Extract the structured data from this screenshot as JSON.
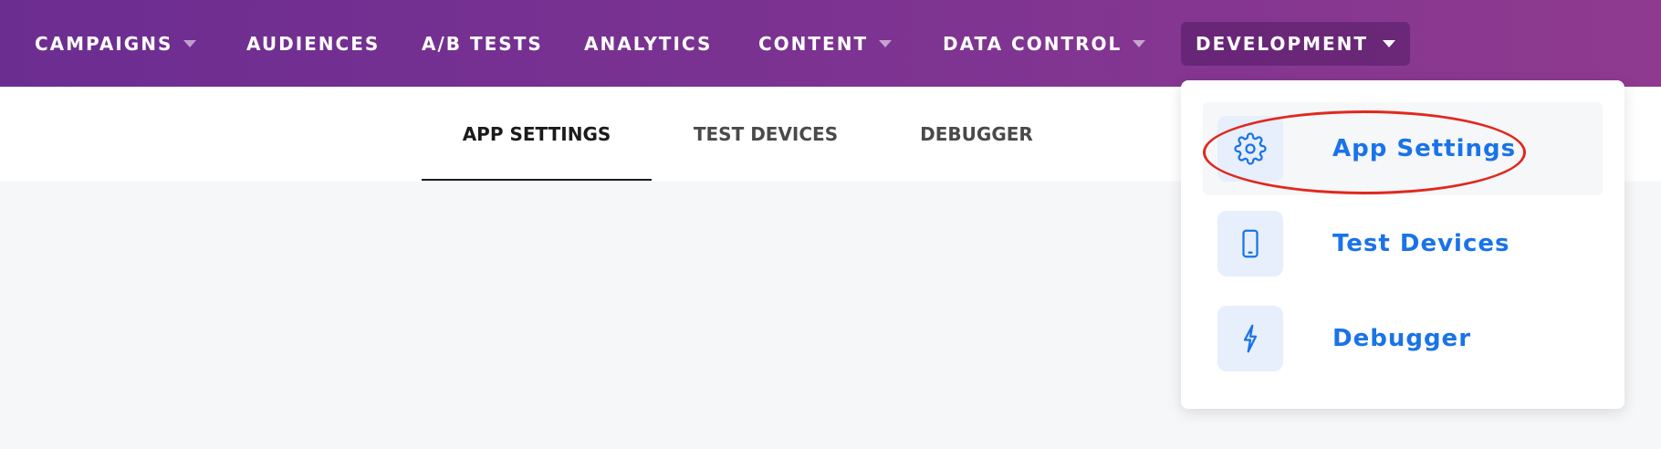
{
  "topnav": {
    "items": [
      {
        "label": "CAMPAIGNS",
        "dropdown": true
      },
      {
        "label": "AUDIENCES",
        "dropdown": false
      },
      {
        "label": "A/B TESTS",
        "dropdown": false
      },
      {
        "label": "ANALYTICS",
        "dropdown": false
      },
      {
        "label": "CONTENT",
        "dropdown": true
      },
      {
        "label": "DATA CONTROL",
        "dropdown": true
      },
      {
        "label": "DEVELOPMENT",
        "dropdown": true,
        "active": true
      }
    ]
  },
  "subnav": {
    "tabs": [
      {
        "label": "APP SETTINGS",
        "active": true
      },
      {
        "label": "TEST DEVICES",
        "active": false
      },
      {
        "label": "DEBUGGER",
        "active": false
      }
    ]
  },
  "dropdown": {
    "items": [
      {
        "label": "App Settings",
        "icon": "gear-icon",
        "highlighted": true
      },
      {
        "label": "Test Devices",
        "icon": "phone-icon",
        "highlighted": false
      },
      {
        "label": "Debugger",
        "icon": "lightning-icon",
        "highlighted": false
      }
    ]
  },
  "colors": {
    "nav_gradient_start": "#6c2d91",
    "nav_gradient_end": "#8f3a90",
    "link_blue": "#1a73e8",
    "annotation_red": "#e0281e"
  }
}
